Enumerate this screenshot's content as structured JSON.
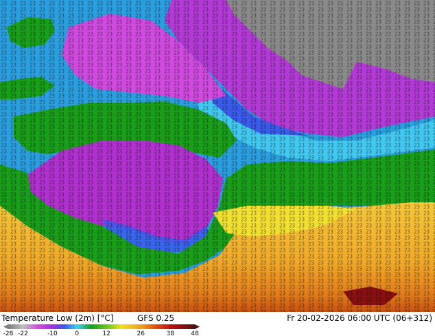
{
  "map": {
    "name": "Temperature Low (2m) [°C] GFS 0.25",
    "grid_label": "23",
    "colors": {
      "sea_cold": "#1fb7e6",
      "land_green": "#189e18",
      "deep_purple": "#a030d8",
      "magenta": "#d04ae0",
      "blue": "#3a5aec",
      "light_blue": "#40d0f0",
      "grey": "#7a7a7a",
      "yellow": "#f0c030",
      "orange": "#e08a20",
      "dark_orange": "#c05010",
      "dark_red": "#8a1010"
    }
  },
  "footer": {
    "title": "Temperature Low (2m) [°C]",
    "model": "GFS 0.25",
    "valid": "Fr 20-02-2026 06:00 UTC (06+312)"
  },
  "colorbar": {
    "ticks": [
      "-28",
      "-22",
      "-10",
      "0",
      "12",
      "26",
      "38",
      "48"
    ],
    "stops": [
      {
        "value": -28,
        "color": "#7d7d7d"
      },
      {
        "value": -22,
        "color": "#c0c0c0"
      },
      {
        "value": -16,
        "color": "#d84ae0"
      },
      {
        "value": -10,
        "color": "#a030d8"
      },
      {
        "value": -5,
        "color": "#3a5aec"
      },
      {
        "value": 0,
        "color": "#40d0f0"
      },
      {
        "value": 6,
        "color": "#189e18"
      },
      {
        "value": 12,
        "color": "#60c820"
      },
      {
        "value": 18,
        "color": "#f0e020"
      },
      {
        "value": 26,
        "color": "#f0a020"
      },
      {
        "value": 32,
        "color": "#e05010"
      },
      {
        "value": 38,
        "color": "#c01010"
      },
      {
        "value": 48,
        "color": "#501010"
      }
    ]
  }
}
